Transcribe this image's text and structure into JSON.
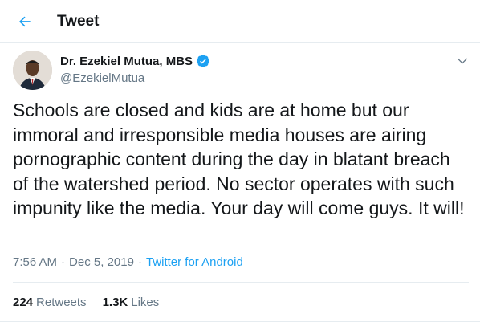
{
  "header": {
    "title": "Tweet",
    "back_icon": "arrow-left-icon"
  },
  "author": {
    "name": "Dr. Ezekiel Mutua, MBS",
    "handle": "@EzekielMutua",
    "verified": true
  },
  "tweet": {
    "text": "Schools are closed and kids are at home but our immoral and irresponsible media houses are airing pornographic content during the day in blatant breach of the watershed period. No sector operates with such impunity like the media. Your day will come guys. It will!",
    "time": "7:56 AM",
    "date": "Dec 5, 2019",
    "separator": "·",
    "source": "Twitter for Android"
  },
  "stats": {
    "retweets_count": "224",
    "retweets_label": "Retweets",
    "likes_count": "1.3K",
    "likes_label": "Likes"
  },
  "colors": {
    "accent": "#1da1f2",
    "secondary_text": "#657786",
    "border": "#e6ecf0"
  }
}
